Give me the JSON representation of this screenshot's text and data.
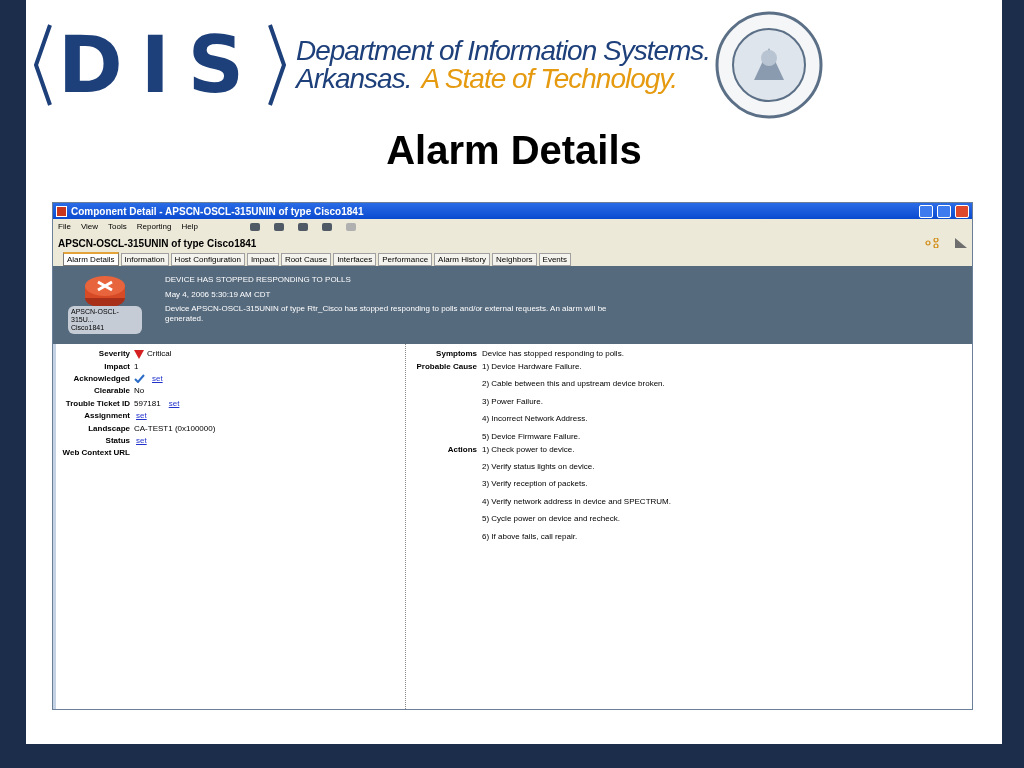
{
  "header": {
    "logo": "DIS",
    "org": "Department of Information Systems.",
    "state": "Arkansas.",
    "slogan": "A State of Technology."
  },
  "slide_title": "Alarm Details",
  "window": {
    "title": "Component Detail - APSCN-OSCL-315UNIN of type Cisco1841",
    "menu": [
      "File",
      "View",
      "Tools",
      "Reporting",
      "Help"
    ],
    "component_title": "APSCN-OSCL-315UNIN of type Cisco1841",
    "tabs": [
      {
        "label": "Alarm Details",
        "selected": true
      },
      {
        "label": "Information",
        "selected": false
      },
      {
        "label": "Host Configuration",
        "selected": false
      },
      {
        "label": "Impact",
        "selected": false
      },
      {
        "label": "Root Cause",
        "selected": false
      },
      {
        "label": "Interfaces",
        "selected": false
      },
      {
        "label": "Performance",
        "selected": false
      },
      {
        "label": "Alarm History",
        "selected": false
      },
      {
        "label": "Neighbors",
        "selected": false
      },
      {
        "label": "Events",
        "selected": false
      }
    ],
    "banner": {
      "device_name": "APSCN-OSCL-315U...",
      "device_type": "Cisco1841",
      "headline": "DEVICE HAS STOPPED RESPONDING TO POLLS",
      "timestamp": "May 4, 2006 5:30:19 AM CDT",
      "message": "Device APSCN-OSCL-315UNIN of type Rtr_Cisco has stopped responding to polls and/or external requests. An alarm will be generated."
    },
    "details": [
      {
        "kind": "severity",
        "label": "Severity",
        "value": "Critical"
      },
      {
        "kind": "text",
        "label": "Impact",
        "value": "1"
      },
      {
        "kind": "check",
        "label": "Acknowledged",
        "checked": true,
        "link": "set"
      },
      {
        "kind": "text",
        "label": "Clearable",
        "value": "No"
      },
      {
        "kind": "text",
        "label": "Trouble Ticket ID",
        "value": "597181",
        "link": "set"
      },
      {
        "kind": "text",
        "label": "Assignment",
        "link": "set"
      },
      {
        "kind": "text",
        "label": "Landscape",
        "value": "CA-TEST1 (0x100000)"
      },
      {
        "kind": "text",
        "label": "Status",
        "link": "set"
      },
      {
        "kind": "text",
        "label": "Web Context URL"
      }
    ],
    "info": [
      {
        "label": "Symptoms",
        "lines": [
          "Device has stopped responding to polls."
        ]
      },
      {
        "label": "Probable Cause",
        "lines": [
          "1) Device Hardware Failure.",
          "2) Cable between this and upstream device broken.",
          "3) Power Failure.",
          "4) Incorrect Network Address.",
          "5) Device Firmware Failure."
        ]
      },
      {
        "label": "Actions",
        "lines": [
          "1) Check power to device.",
          "2) Verify status lights on device.",
          "3) Verify reception of packets.",
          "4) Verify network address in device and SPECTRUM.",
          "5) Cycle power on device and recheck.",
          "6) If above fails, call repair."
        ]
      }
    ]
  }
}
